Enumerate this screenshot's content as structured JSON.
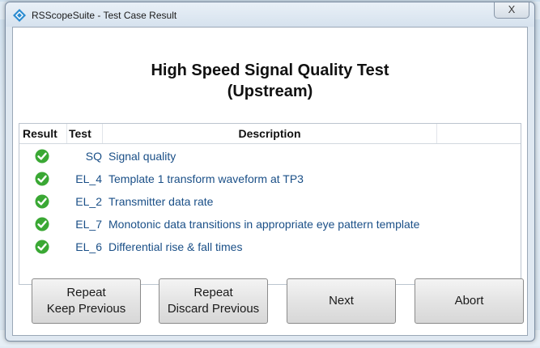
{
  "window": {
    "title": "RSScopeSuite - Test Case Result",
    "close_glyph": "X"
  },
  "heading": {
    "line1": "High Speed Signal Quality Test",
    "line2": "(Upstream)"
  },
  "table": {
    "headers": {
      "result": "Result",
      "test": "Test",
      "description": "Description"
    },
    "rows": [
      {
        "result_icon": "check-icon",
        "status": "pass",
        "test": "SQ",
        "description": "Signal quality"
      },
      {
        "result_icon": "check-icon",
        "status": "pass",
        "test": "EL_4",
        "description": "Template 1 transform waveform at TP3"
      },
      {
        "result_icon": "check-icon",
        "status": "pass",
        "test": "EL_2",
        "description": "Transmitter data rate"
      },
      {
        "result_icon": "check-icon",
        "status": "pass",
        "test": "EL_7",
        "description": "Monotonic data transitions in appropriate eye pattern template"
      },
      {
        "result_icon": "check-icon",
        "status": "pass",
        "test": "EL_6",
        "description": "Differential rise & fall times"
      }
    ]
  },
  "buttons": {
    "repeat_keep": {
      "line1": "Repeat",
      "line2": "Keep Previous"
    },
    "repeat_discard": {
      "line1": "Repeat",
      "line2": "Discard Previous"
    },
    "next": "Next",
    "abort": "Abort"
  },
  "colors": {
    "pass_green": "#3aa834",
    "link_blue": "#1a4f87",
    "app_icon_blue": "#2a8bd0"
  }
}
